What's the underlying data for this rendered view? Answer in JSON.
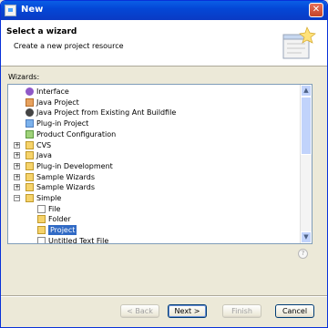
{
  "window": {
    "title": "New"
  },
  "header": {
    "title": "Select a wizard",
    "description": "Create a new project resource"
  },
  "wizards_label": "Wizards:",
  "tree": {
    "items": [
      {
        "label": "Interface",
        "icon": "interface-icon"
      },
      {
        "label": "Java Project",
        "icon": "java-project-icon"
      },
      {
        "label": "Java Project from Existing Ant Buildfile",
        "icon": "ant-icon"
      },
      {
        "label": "Plug-in Project",
        "icon": "plugin-project-icon"
      },
      {
        "label": "Product Configuration",
        "icon": "product-config-icon"
      },
      {
        "label": "CVS",
        "icon": "folder-icon",
        "expander": "+"
      },
      {
        "label": "Java",
        "icon": "folder-icon",
        "expander": "+"
      },
      {
        "label": "Plug-in Development",
        "icon": "folder-icon",
        "expander": "+"
      },
      {
        "label": "Sample Wizards",
        "icon": "folder-icon",
        "expander": "+"
      },
      {
        "label": "Sample Wizards",
        "icon": "folder-icon",
        "expander": "+"
      },
      {
        "label": "Simple",
        "icon": "folder-open-icon",
        "expander": "−"
      },
      {
        "label": "File",
        "icon": "file-icon"
      },
      {
        "label": "Folder",
        "icon": "folder-icon"
      },
      {
        "label": "Project",
        "icon": "project-icon",
        "selected": true
      },
      {
        "label": "Untitled Text File",
        "icon": "text-file-icon"
      }
    ]
  },
  "buttons": {
    "back": "< Back",
    "next": "Next >",
    "finish": "Finish",
    "cancel": "Cancel"
  },
  "help_symbol": "?"
}
